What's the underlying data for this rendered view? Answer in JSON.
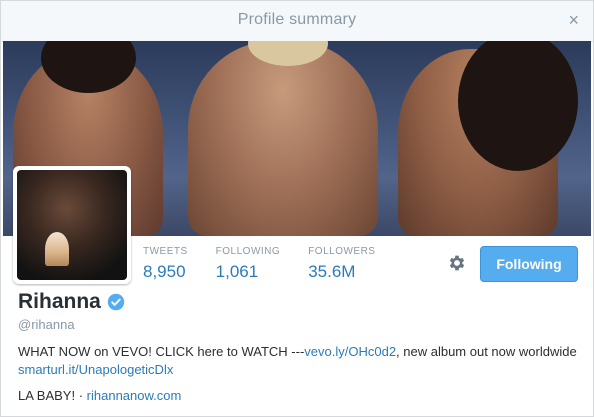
{
  "dialog": {
    "title": "Profile summary",
    "close_icon": "×"
  },
  "profile": {
    "name": "Rihanna",
    "handle": "@rihanna",
    "verified_icon": "verified-badge-icon",
    "follow_button_label": "Following",
    "stats": [
      {
        "label": "TWEETS",
        "value": "8,950"
      },
      {
        "label": "FOLLOWING",
        "value": "1,061"
      },
      {
        "label": "FOLLOWERS",
        "value": "35.6M"
      }
    ],
    "bio": {
      "part1": "WHAT NOW on VEVO! CLICK here to WATCH ---",
      "link1": "vevo.ly/OHc0d2",
      "part2": ", new album out now worldwide ",
      "link2": "smarturl.it/UnapologeticDlx"
    },
    "location": "LA BABY!",
    "separator": " · ",
    "website": "rihannanow.com"
  },
  "colors": {
    "accent": "#55acee",
    "link": "#2b7bb9",
    "muted": "#8899a6",
    "text": "#292f33"
  }
}
